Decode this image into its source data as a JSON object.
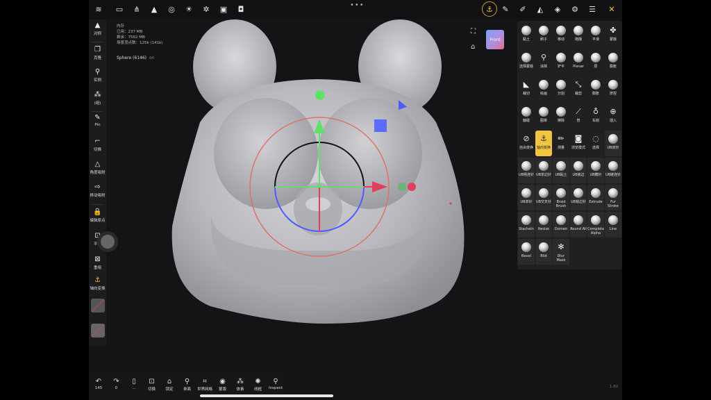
{
  "stats": {
    "memory_label": "内存",
    "used": "已用：237 MB",
    "remaining": "剩余：7562 MB",
    "vertex_count": "场景顶点数：125k (141k)"
  },
  "object": {
    "name": "Sphere (6146)",
    "toggle": "on"
  },
  "viewport": {
    "front_label": "Front",
    "version": "1.82"
  },
  "left_toolbar": [
    {
      "icon": "triangle-icon",
      "glyph": "▲",
      "label": "对称"
    },
    {
      "icon": "clone-icon",
      "glyph": "❐",
      "label": "克隆"
    },
    {
      "icon": "instance-icon",
      "glyph": "⚲",
      "label": "实例"
    },
    {
      "icon": "hierarchy-icon",
      "glyph": "⁂",
      "label": "(组)"
    },
    {
      "icon": "pin-icon",
      "glyph": "✎",
      "label": "Pin"
    },
    {
      "icon": "cut-icon",
      "glyph": "⌐",
      "label": "切换"
    },
    {
      "icon": "angle-snap-icon",
      "glyph": "△",
      "label": "角度吸附"
    },
    {
      "icon": "move-snap-icon",
      "glyph": "⇨",
      "label": "移动吸附"
    },
    {
      "icon": "lock-icon",
      "glyph": "🔒",
      "label": "编辑原点"
    },
    {
      "icon": "flat-icon",
      "glyph": "⊡",
      "label": "平滑"
    },
    {
      "icon": "replace-icon",
      "glyph": "⊠",
      "label": "重组"
    },
    {
      "icon": "gizmo-icon",
      "glyph": "⚓",
      "label": "轴向变换"
    }
  ],
  "brushes": [
    {
      "label": "黏土",
      "icon": "ball"
    },
    {
      "label": "刷子",
      "icon": "ball"
    },
    {
      "label": "移动",
      "icon": "ball"
    },
    {
      "label": "拖拽",
      "icon": "ball"
    },
    {
      "label": "平滑",
      "icon": "ball"
    },
    {
      "label": "蒙版",
      "icon": "puzzle-icon",
      "glyph": "✤"
    },
    {
      "label": "选择蒙版",
      "icon": "ball"
    },
    {
      "label": "涂抹",
      "icon": "smudge-icon",
      "glyph": "⚲"
    },
    {
      "label": "铲平",
      "icon": "ball"
    },
    {
      "label": "Planar",
      "icon": "ball"
    },
    {
      "label": "层",
      "icon": "ball"
    },
    {
      "label": "膨胀",
      "icon": "ball"
    },
    {
      "label": "裁切",
      "icon": "trim-icon",
      "glyph": "◣"
    },
    {
      "label": "绘画",
      "icon": "ball"
    },
    {
      "label": "分割",
      "icon": "ball"
    },
    {
      "label": "裁剪",
      "icon": "slice-icon",
      "glyph": "⤡"
    },
    {
      "label": "膨胀",
      "icon": "ball"
    },
    {
      "label": "挤捏",
      "icon": "ball"
    },
    {
      "label": "触碰",
      "icon": "ball"
    },
    {
      "label": "图章",
      "icon": "ball"
    },
    {
      "label": "擦除",
      "icon": "ball"
    },
    {
      "label": "管",
      "icon": "tube-icon",
      "glyph": "⟋"
    },
    {
      "label": "车削",
      "icon": "lathe-icon",
      "glyph": "♁"
    },
    {
      "label": "插入",
      "icon": "insert-icon",
      "glyph": "⊕"
    },
    {
      "label": "自由变换",
      "icon": "transform-icon",
      "glyph": "⊘"
    },
    {
      "label": "轴向变换",
      "icon": "gizmo-icon",
      "glyph": "⚓",
      "selected": true
    },
    {
      "label": "测量",
      "icon": "measure-icon",
      "glyph": "✏"
    },
    {
      "label": "浏览模式",
      "icon": "camera-icon",
      "glyph": "◙"
    },
    {
      "label": "选择",
      "icon": "select-icon",
      "glyph": "◌"
    },
    {
      "label": "UB双针",
      "icon": "ball",
      "dark": true
    },
    {
      "label": "UB杨连针",
      "icon": "ball",
      "dark": true
    },
    {
      "label": "UB单边针",
      "icon": "ball",
      "dark": true
    },
    {
      "label": "UB黏土",
      "icon": "ball",
      "dark": true
    },
    {
      "label": "UB锁边",
      "icon": "ball",
      "dark": true
    },
    {
      "label": "UB藏针",
      "icon": "ball",
      "dark": true
    },
    {
      "label": "UB链连针",
      "icon": "ball",
      "dark": true
    },
    {
      "label": "UB单针",
      "icon": "ball",
      "dark": true
    },
    {
      "label": "UB交叉针",
      "icon": "ball",
      "dark": true
    },
    {
      "label": "Braid Brush",
      "icon": "ball",
      "dark": true
    },
    {
      "label": "UB锁边针",
      "icon": "ball",
      "dark": true
    },
    {
      "label": "Extrude",
      "icon": "ball",
      "dark": true
    },
    {
      "label": "Fur Stroke",
      "icon": "ball",
      "dark": true
    },
    {
      "label": "Stacheln",
      "icon": "ball",
      "dark": true
    },
    {
      "label": "Resize",
      "icon": "ball",
      "dark": true
    },
    {
      "label": "Dornen",
      "icon": "ball",
      "dark": true
    },
    {
      "label": "Round All",
      "icon": "ball",
      "dark": true
    },
    {
      "label": "Complete Alpha",
      "icon": "ball",
      "dark": true
    },
    {
      "label": "Line",
      "icon": "ball",
      "dark": true
    },
    {
      "label": "Bevel",
      "icon": "ball",
      "dark": true
    },
    {
      "label": "Bild",
      "icon": "ball",
      "dark": true
    },
    {
      "label": "Blur Mask",
      "icon": "blur-icon",
      "glyph": "✻",
      "dark": true
    }
  ],
  "bottom_toolbar": [
    {
      "icon": "undo-icon",
      "glyph": "↶",
      "label": "145"
    },
    {
      "icon": "redo-icon",
      "glyph": "↷",
      "label": "0"
    },
    {
      "icon": "phone-icon",
      "glyph": "▯",
      "label": "..."
    },
    {
      "icon": "cut-icon",
      "glyph": "⊡",
      "label": "切换"
    },
    {
      "icon": "lock-icon",
      "glyph": "⌂",
      "label": "锁定"
    },
    {
      "icon": "search-icon",
      "glyph": "⚲",
      "label": "单面"
    },
    {
      "icon": "grid-icon",
      "glyph": "⌗",
      "label": "世界网格"
    },
    {
      "icon": "eye-icon",
      "glyph": "◉",
      "label": "蒙版"
    },
    {
      "icon": "hierarchy-icon",
      "glyph": "⁂",
      "label": "体素"
    },
    {
      "icon": "wireframe-icon",
      "glyph": "✺",
      "label": "线框"
    },
    {
      "icon": "inspect-icon",
      "glyph": "⚲",
      "label": "Inspect"
    }
  ],
  "colors": {
    "accent_yellow": "#f1c441",
    "gizmo_red": "#e0405a",
    "gizmo_green": "#5ee26a",
    "gizmo_blue": "#5a6bff"
  }
}
